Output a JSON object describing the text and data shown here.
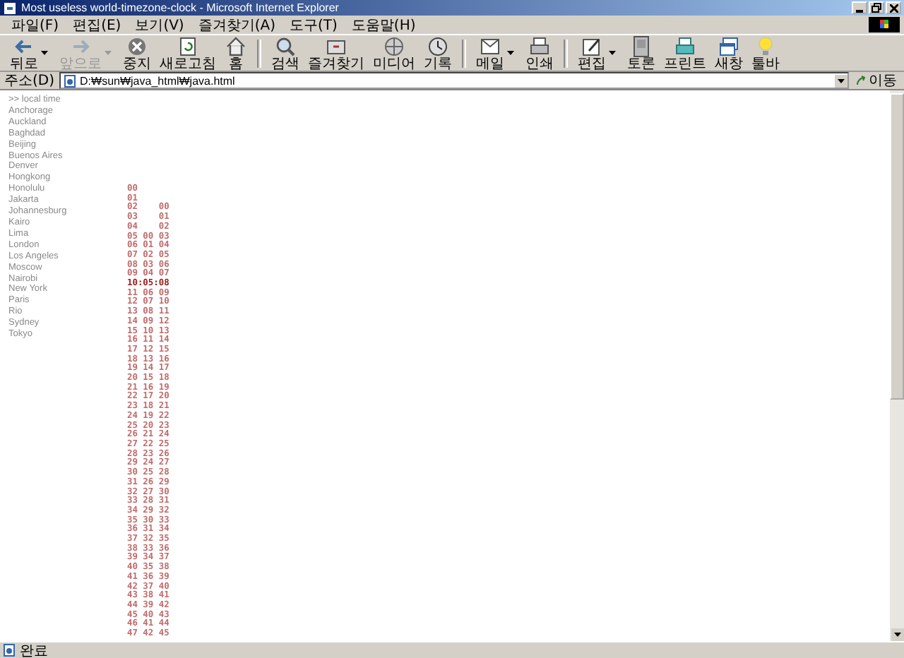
{
  "window": {
    "title": "Most useless world-timezone-clock - Microsoft Internet Explorer"
  },
  "menu": [
    "파일(F)",
    "편집(E)",
    "보기(V)",
    "즐겨찾기(A)",
    "도구(T)",
    "도움말(H)"
  ],
  "toolbar": {
    "groups": [
      [
        {
          "label": "뒤로",
          "disabled": false,
          "dropdown": true
        },
        {
          "label": "앞으로",
          "disabled": true,
          "dropdown": true
        },
        {
          "label": "중지",
          "disabled": false,
          "dropdown": false
        },
        {
          "label": "새로고침",
          "disabled": false,
          "dropdown": false
        },
        {
          "label": "홈",
          "disabled": false,
          "dropdown": false
        }
      ],
      [
        {
          "label": "검색",
          "disabled": false,
          "dropdown": false
        },
        {
          "label": "즐겨찾기",
          "disabled": false,
          "dropdown": false
        },
        {
          "label": "미디어",
          "disabled": false,
          "dropdown": false
        },
        {
          "label": "기록",
          "disabled": false,
          "dropdown": false
        }
      ],
      [
        {
          "label": "메일",
          "disabled": false,
          "dropdown": true
        },
        {
          "label": "인쇄",
          "disabled": false,
          "dropdown": false
        }
      ],
      [
        {
          "label": "편집",
          "disabled": false,
          "dropdown": true
        },
        {
          "label": "토론",
          "disabled": false,
          "dropdown": false
        },
        {
          "label": "프린트",
          "disabled": false,
          "dropdown": false
        },
        {
          "label": "새창",
          "disabled": false,
          "dropdown": false
        },
        {
          "label": "툴바",
          "disabled": false,
          "dropdown": false
        }
      ]
    ]
  },
  "address": {
    "label": "주소(D)",
    "value": "D:₩sun₩java_html₩java.html",
    "go": "이동"
  },
  "cities": [
    ">> local time",
    "Anchorage",
    "Auckland",
    "Baghdad",
    "Beijing",
    "Buenos Aires",
    "Denver",
    "Hongkong",
    "Honolulu",
    "Jakarta",
    "Johannesburg",
    "Kairo",
    "Lima",
    "London",
    "Los Angeles",
    "Moscow",
    "Nairobi",
    "New York",
    "Paris",
    "Rio",
    "Sydney",
    "Tokyo"
  ],
  "clock_rows": [
    {
      "text": "00",
      "current": false
    },
    {
      "text": "01",
      "current": false
    },
    {
      "text": "02    00",
      "current": false
    },
    {
      "text": "03    01",
      "current": false
    },
    {
      "text": "04    02",
      "current": false
    },
    {
      "text": "05 00 03",
      "current": false
    },
    {
      "text": "06 01 04",
      "current": false
    },
    {
      "text": "07 02 05",
      "current": false
    },
    {
      "text": "08 03 06",
      "current": false
    },
    {
      "text": "09 04 07",
      "current": false
    },
    {
      "text": "10:05:08",
      "current": true
    },
    {
      "text": "11 06 09",
      "current": false
    },
    {
      "text": "12 07 10",
      "current": false
    },
    {
      "text": "13 08 11",
      "current": false
    },
    {
      "text": "14 09 12",
      "current": false
    },
    {
      "text": "15 10 13",
      "current": false
    },
    {
      "text": "16 11 14",
      "current": false
    },
    {
      "text": "17 12 15",
      "current": false
    },
    {
      "text": "18 13 16",
      "current": false
    },
    {
      "text": "19 14 17",
      "current": false
    },
    {
      "text": "20 15 18",
      "current": false
    },
    {
      "text": "21 16 19",
      "current": false
    },
    {
      "text": "22 17 20",
      "current": false
    },
    {
      "text": "23 18 21",
      "current": false
    },
    {
      "text": "24 19 22",
      "current": false
    },
    {
      "text": "25 20 23",
      "current": false
    },
    {
      "text": "26 21 24",
      "current": false
    },
    {
      "text": "27 22 25",
      "current": false
    },
    {
      "text": "28 23 26",
      "current": false
    },
    {
      "text": "29 24 27",
      "current": false
    },
    {
      "text": "30 25 28",
      "current": false
    },
    {
      "text": "31 26 29",
      "current": false
    },
    {
      "text": "32 27 30",
      "current": false
    },
    {
      "text": "33 28 31",
      "current": false
    },
    {
      "text": "34 29 32",
      "current": false
    },
    {
      "text": "35 30 33",
      "current": false
    },
    {
      "text": "36 31 34",
      "current": false
    },
    {
      "text": "37 32 35",
      "current": false
    },
    {
      "text": "38 33 36",
      "current": false
    },
    {
      "text": "39 34 37",
      "current": false
    },
    {
      "text": "40 35 38",
      "current": false
    },
    {
      "text": "41 36 39",
      "current": false
    },
    {
      "text": "42 37 40",
      "current": false
    },
    {
      "text": "43 38 41",
      "current": false
    },
    {
      "text": "44 39 42",
      "current": false
    },
    {
      "text": "45 40 43",
      "current": false
    },
    {
      "text": "46 41 44",
      "current": false
    },
    {
      "text": "47 42 45",
      "current": false
    }
  ],
  "status_bar": {
    "text": "완료"
  }
}
